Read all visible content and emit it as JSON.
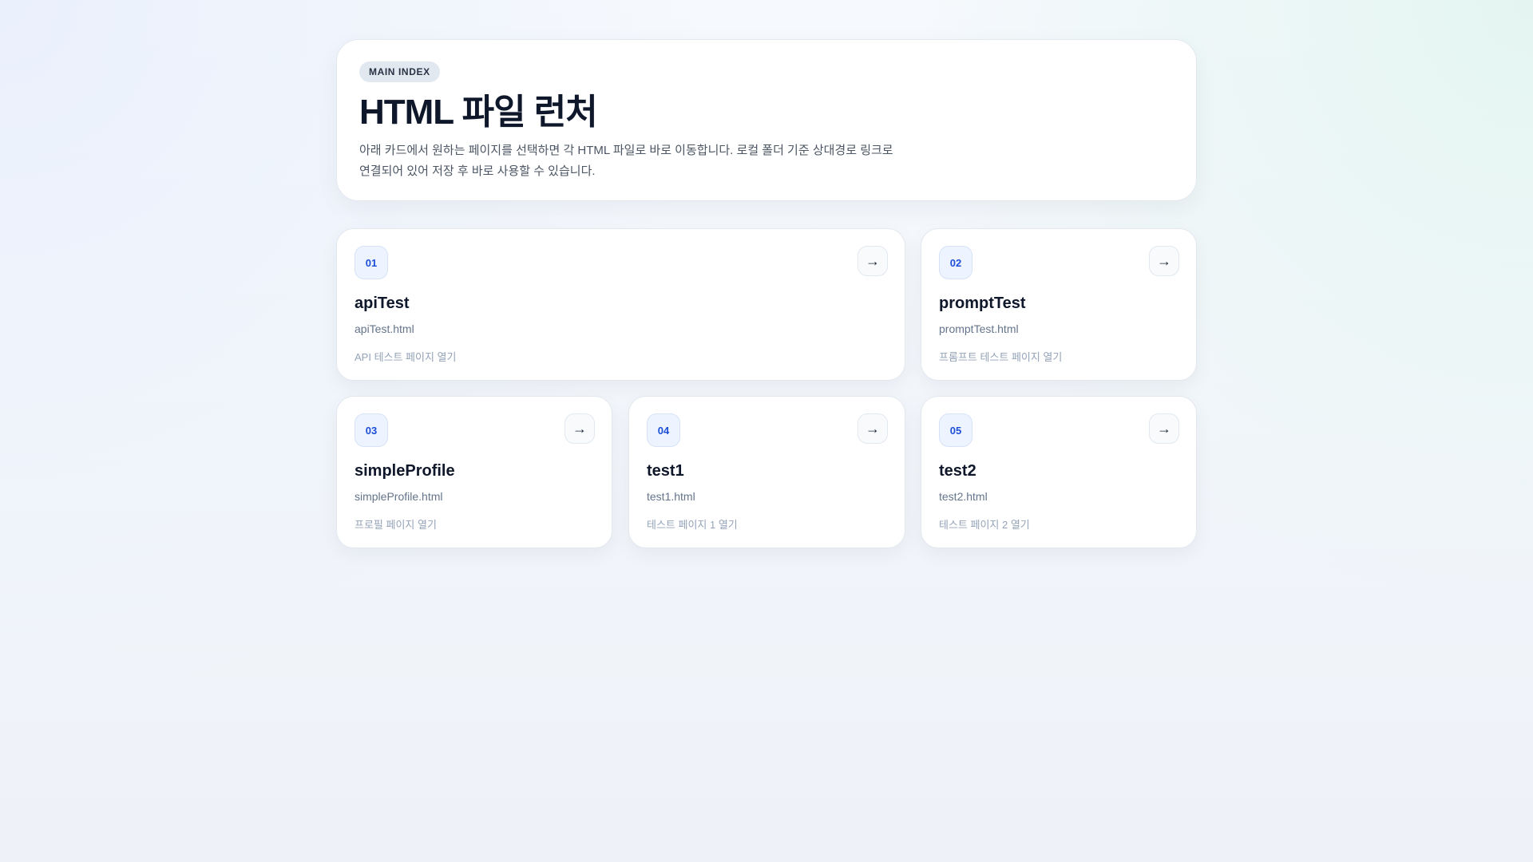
{
  "hero": {
    "badge": "MAIN INDEX",
    "title": "HTML 파일 런처",
    "description_line1": "아래 카드에서 원하는 페이지를 선택하면 각 HTML 파일로 바로 이동합니다. 로컬 폴더 기준 상대경로 링크로",
    "description_line2": "연결되어 있어 저장 후 바로 사용할 수 있습니다."
  },
  "cards": [
    {
      "number": "01",
      "title": "apiTest",
      "file": "apiTest.html",
      "description": "API 테스트 페이지 열기",
      "arrow": "→"
    },
    {
      "number": "02",
      "title": "promptTest",
      "file": "promptTest.html",
      "description": "프롬프트 테스트 페이지 열기",
      "arrow": "→"
    },
    {
      "number": "03",
      "title": "simpleProfile",
      "file": "simpleProfile.html",
      "description": "프로필 페이지 열기",
      "arrow": "→"
    },
    {
      "number": "04",
      "title": "test1",
      "file": "test1.html",
      "description": "테스트 페이지 1 열기",
      "arrow": "→"
    },
    {
      "number": "05",
      "title": "test2",
      "file": "test2.html",
      "description": "테스트 페이지 2 열기",
      "arrow": "→"
    }
  ],
  "colors": {
    "accent": "#1d4ed8",
    "title": "#0f172a",
    "muted": "#64748b"
  },
  "icons": {
    "arrow": "arrow-right-icon"
  }
}
